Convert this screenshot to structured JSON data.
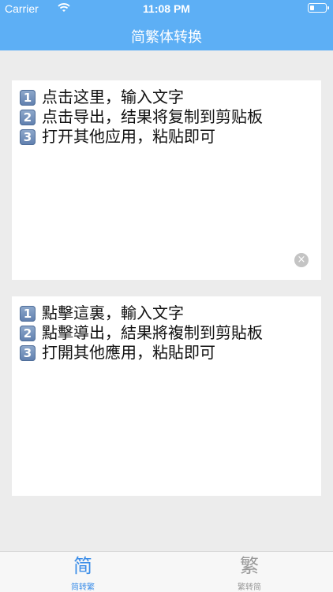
{
  "status_bar": {
    "carrier": "Carrier",
    "time": "11:08 PM",
    "wifi_icon": "wifi-icon",
    "battery_icon": "battery-icon"
  },
  "nav": {
    "title": "简繁体转换",
    "background": "#5daff5"
  },
  "simplified_panel": {
    "lines": [
      {
        "num": "1",
        "text": "点击这里，输入文字"
      },
      {
        "num": "2",
        "text": "点击导出，结果将复制到剪贴板"
      },
      {
        "num": "3",
        "text": "打开其他应用，粘贴即可"
      }
    ],
    "clear_icon": "clear-icon"
  },
  "traditional_panel": {
    "lines": [
      {
        "num": "1",
        "text": "點擊這裏，輸入文字"
      },
      {
        "num": "2",
        "text": "點擊導出，結果將複制到剪貼板"
      },
      {
        "num": "3",
        "text": "打開其他應用，粘貼即可"
      }
    ]
  },
  "tabbar": {
    "tabs": [
      {
        "glyph": "简",
        "label": "简转繁",
        "active": true
      },
      {
        "glyph": "繁",
        "label": "繁转简",
        "active": false
      }
    ],
    "active_color": "#3b8de8",
    "inactive_color": "#999999"
  }
}
